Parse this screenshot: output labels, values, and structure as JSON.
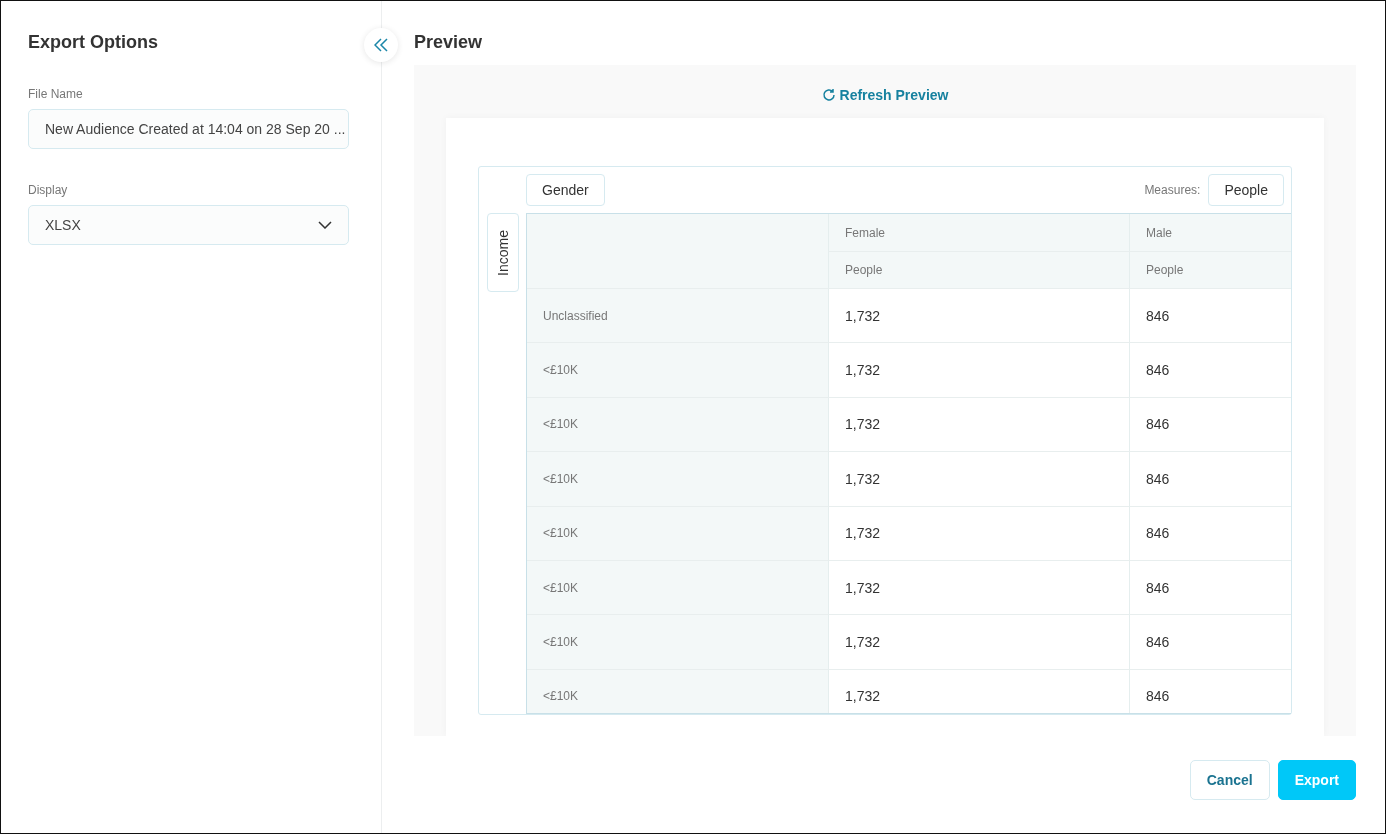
{
  "sidebar": {
    "title": "Export Options",
    "file_name": {
      "label": "File Name",
      "value": "New Audience Created at 14:04 on 28 Sep 20 ..."
    },
    "display": {
      "label": "Display",
      "value": "XLSX"
    }
  },
  "preview": {
    "title": "Preview",
    "refresh": "Refresh Preview",
    "column_dimension": "Gender",
    "row_dimension": "Income",
    "measures_label": "Measures:",
    "measure": "People",
    "columns": [
      {
        "name": "Female",
        "measure": "People"
      },
      {
        "name": "Male",
        "measure": "People"
      }
    ],
    "rows": [
      {
        "label": "Unclassified",
        "values": [
          "1,732",
          "846"
        ]
      },
      {
        "label": "<£10K",
        "values": [
          "1,732",
          "846"
        ]
      },
      {
        "label": "<£10K",
        "values": [
          "1,732",
          "846"
        ]
      },
      {
        "label": "<£10K",
        "values": [
          "1,732",
          "846"
        ]
      },
      {
        "label": "<£10K",
        "values": [
          "1,732",
          "846"
        ]
      },
      {
        "label": "<£10K",
        "values": [
          "1,732",
          "846"
        ]
      },
      {
        "label": "<£10K",
        "values": [
          "1,732",
          "846"
        ]
      },
      {
        "label": "<£10K",
        "values": [
          "1,732",
          "846"
        ]
      }
    ]
  },
  "buttons": [
    {
      "label": "Cancel",
      "kind": "secondary"
    },
    {
      "label": "Export",
      "kind": "primary"
    }
  ]
}
